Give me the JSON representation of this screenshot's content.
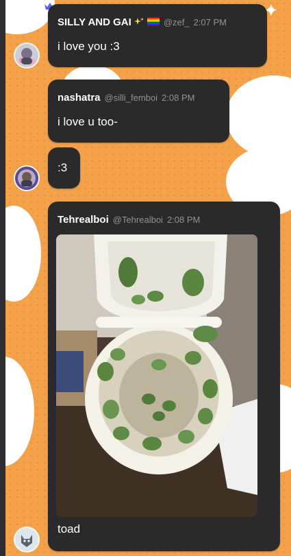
{
  "messages": [
    {
      "author": "SILLY AND GAI",
      "handle": "@zef_",
      "time": "2:07 PM",
      "text": "i love you :3"
    },
    {
      "author": "nashatra",
      "handle": "@silli_femboi",
      "time": "2:08 PM",
      "text": "i love u too-"
    },
    {
      "text": ":3"
    },
    {
      "author": "Tehrealboi",
      "handle": "@Tehrealboi",
      "time": "2:08 PM",
      "text": "toad",
      "image": "photo of green frogs in a toilet"
    }
  ],
  "icons": {
    "crown": "crown-icon",
    "sparkle_emoji": "sparkles",
    "flag_emoji": "rainbow-flag"
  },
  "colors": {
    "bubble": "#2b2a2a",
    "background": "#f3a24a",
    "name_text": "#ffffff",
    "meta_text": "#8e9297",
    "crown": "#5865f2"
  }
}
